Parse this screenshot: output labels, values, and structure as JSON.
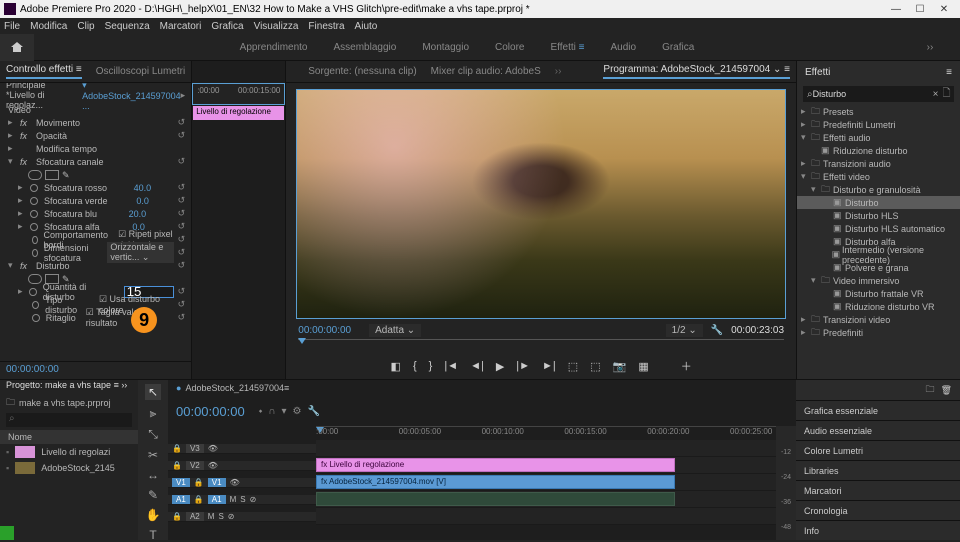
{
  "titlebar": {
    "text": "Adobe Premiere Pro 2020 - D:\\HGH\\_helpX\\01_EN\\32 How to Make a VHS Glitch\\pre-edit\\make a vhs tape.prproj *"
  },
  "menubar": [
    "File",
    "Modifica",
    "Clip",
    "Sequenza",
    "Marcatori",
    "Grafica",
    "Visualizza",
    "Finestra",
    "Aiuto"
  ],
  "workspaces": {
    "items": [
      "Apprendimento",
      "Assemblaggio",
      "Montaggio",
      "Colore",
      "Effetti",
      "Audio",
      "Grafica"
    ],
    "active": "Effetti"
  },
  "leftTabs": [
    "Controllo effetti",
    "Oscilloscopi Lumetri",
    "Sorgente: (nessuna clip)",
    "Mixer clip audio: AdobeS"
  ],
  "effectControls": {
    "sourceLabel": "Principale *Livello di regolaz...",
    "sourceLink": "AdobeStock_214597004 ...",
    "groups": {
      "video": "Video",
      "movimento": "Movimento",
      "opacita": "Opacità",
      "tempo": "Modifica tempo",
      "sfocatura": {
        "name": "Sfocatura canale",
        "rosso": {
          "label": "Sfocatura rosso",
          "value": "40.0"
        },
        "verde": {
          "label": "Sfocatura verde",
          "value": "0.0"
        },
        "blu": {
          "label": "Sfocatura blu",
          "value": "20.0"
        },
        "alfa": {
          "label": "Sfocatura alfa",
          "value": "0.0"
        },
        "bordi": {
          "label": "Comportamento bordi",
          "check": "Ripeti pixel del bordo"
        },
        "dim": {
          "label": "Dimensioni sfocatura",
          "value": "Orizzontale e vertic..."
        }
      },
      "disturbo": {
        "name": "Disturbo",
        "quantita": {
          "label": "Quantità di disturbo",
          "value": "15"
        },
        "tipo": {
          "label": "Tipo disturbo",
          "check": "Usa disturbo colore"
        },
        "ritaglio": {
          "label": "Ritaglio",
          "check": "Taglia valori risultato"
        }
      }
    },
    "timecode": "00:00:00:00",
    "callout": "9"
  },
  "midTimeline": {
    "marks": [
      ":00:00",
      "00:00:15:00"
    ],
    "clip": "Livello di regolazione"
  },
  "program": {
    "tab": "Programma: AdobeStock_214597004",
    "tcLeft": "00:00:00:00",
    "fit": "Adatta",
    "zoom": "1/2",
    "tcRight": "00:00:23:03"
  },
  "effects": {
    "tab": "Effetti",
    "search": "Disturbo",
    "tree": [
      {
        "lvl": 0,
        "chev": "▸",
        "label": "Presets"
      },
      {
        "lvl": 0,
        "chev": "▸",
        "label": "Predefiniti Lumetri"
      },
      {
        "lvl": 0,
        "chev": "▾",
        "label": "Effetti audio"
      },
      {
        "lvl": 1,
        "chev": "",
        "icon": "fx",
        "label": "Riduzione disturbo"
      },
      {
        "lvl": 0,
        "chev": "▸",
        "label": "Transizioni audio"
      },
      {
        "lvl": 0,
        "chev": "▾",
        "label": "Effetti video"
      },
      {
        "lvl": 1,
        "chev": "▾",
        "label": "Disturbo e granulosità"
      },
      {
        "lvl": 2,
        "chev": "",
        "icon": "fx",
        "label": "Disturbo",
        "sel": true
      },
      {
        "lvl": 2,
        "chev": "",
        "icon": "fx",
        "label": "Disturbo HLS"
      },
      {
        "lvl": 2,
        "chev": "",
        "icon": "fx",
        "label": "Disturbo HLS automatico"
      },
      {
        "lvl": 2,
        "chev": "",
        "icon": "fx",
        "label": "Disturbo alfa"
      },
      {
        "lvl": 2,
        "chev": "",
        "icon": "fx",
        "label": "Intermedio (versione precedente)"
      },
      {
        "lvl": 2,
        "chev": "",
        "icon": "fx",
        "label": "Polvere e grana"
      },
      {
        "lvl": 1,
        "chev": "▾",
        "label": "Video immersivo"
      },
      {
        "lvl": 2,
        "chev": "",
        "icon": "fx",
        "label": "Disturbo frattale VR"
      },
      {
        "lvl": 2,
        "chev": "",
        "icon": "fx",
        "label": "Riduzione disturbo VR"
      },
      {
        "lvl": 0,
        "chev": "▸",
        "label": "Transizioni video"
      },
      {
        "lvl": 0,
        "chev": "▸",
        "label": "Predefiniti"
      }
    ]
  },
  "project": {
    "tab": "Progetto: make a vhs tape",
    "file": "make a vhs tape.prproj",
    "col": "Nome",
    "items": [
      {
        "label": "Livello di regolazi"
      },
      {
        "label": "AdobeStock_2145"
      }
    ]
  },
  "timeline": {
    "tab": "AdobeStock_214597004",
    "tc": "00:00:00:00",
    "ruler": [
      ":00:00",
      "00:00:05:00",
      "00:00:10:00",
      "00:00:15:00",
      "00:00:20:00",
      "00:00:25:00"
    ],
    "tracks": {
      "v3": "V3",
      "v2": "V2",
      "v1": "V1",
      "a1": "A1",
      "a2": "A2"
    },
    "clips": {
      "v2": "Livello di regolazione",
      "v1": "AdobeStock_214597004.mov [V]"
    },
    "levels": [
      "-12",
      "-24",
      "-36",
      "-48"
    ]
  },
  "sidePanels": [
    "Grafica essenziale",
    "Audio essenziale",
    "Colore Lumetri",
    "Libraries",
    "Marcatori",
    "Cronologia",
    "Info"
  ]
}
